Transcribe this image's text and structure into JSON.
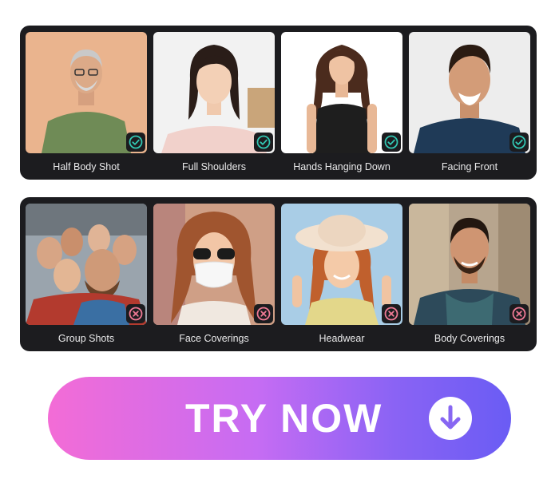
{
  "allowed_examples": {
    "items": [
      {
        "label": "Half Body Shot",
        "status": "check-icon"
      },
      {
        "label": "Full Shoulders",
        "status": "check-icon"
      },
      {
        "label": "Hands Hanging Down",
        "status": "check-icon"
      },
      {
        "label": "Facing Front",
        "status": "check-icon"
      }
    ]
  },
  "disallowed_examples": {
    "items": [
      {
        "label": "Group Shots",
        "status": "cross-icon"
      },
      {
        "label": "Face Coverings",
        "status": "cross-icon"
      },
      {
        "label": "Headwear",
        "status": "cross-icon"
      },
      {
        "label": "Body Coverings",
        "status": "cross-icon"
      }
    ]
  },
  "cta": {
    "label": "TRY NOW",
    "icon": "download-arrow-icon"
  },
  "colors": {
    "panel_bg": "#1c1c1f",
    "check": "#32c6b2",
    "cross": "#f07a95",
    "cta_gradient_start": "#f36cd6",
    "cta_gradient_end": "#6a5cf4"
  }
}
